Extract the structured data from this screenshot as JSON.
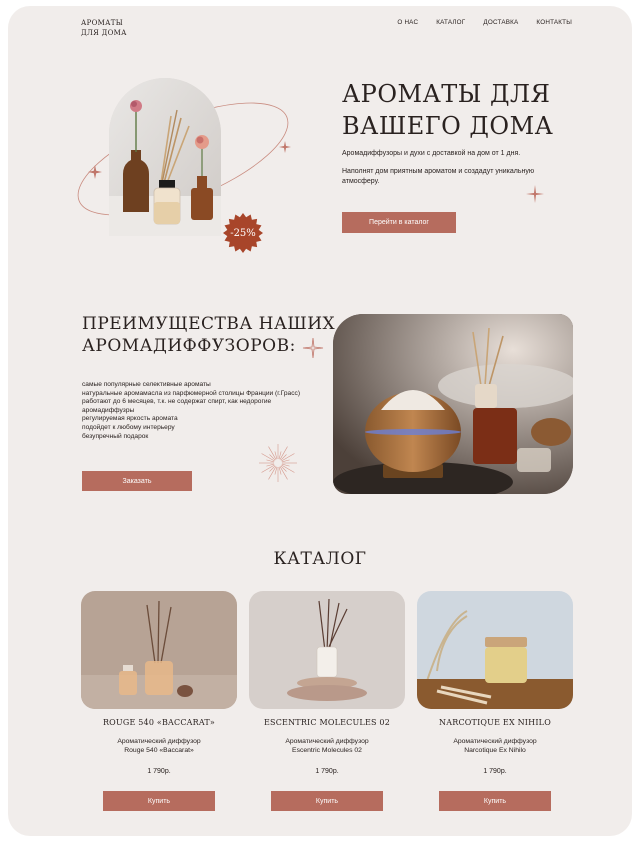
{
  "header": {
    "logo_line1": "АРОМАТЫ",
    "logo_line2": "ДЛЯ ДОМА",
    "nav": [
      "О НАС",
      "КАТАЛОГ",
      "ДОСТАВКА",
      "КОНТАКТЫ"
    ]
  },
  "hero": {
    "title_line1": "АРОМАТЫ ДЛЯ",
    "title_line2": "ВАШЕГО ДОМА",
    "subtitle": "Аромадиффузоры и духи с доставкой на дом от 1 дня.",
    "text": "Наполнят дом приятным ароматом и создадут уникальную атмосферу.",
    "button": "Перейти в каталог",
    "badge": "-25%"
  },
  "advantages": {
    "title_line1": "ПРЕИМУЩЕСТВА НАШИХ",
    "title_line2": "АРОМАДИФФУЗОРОВ:",
    "items": [
      "самые популярные селективные ароматы",
      "натуральные аромамасла из парфюмерной столицы Франции (г.Грасс)",
      "работают до 6 месяцев, т.к. не содержат спирт, как недорогие аромадиффузры",
      "регулируемая яркость аромата",
      "подойдет к любому интерьеру",
      "безупречный подарок"
    ],
    "button": "Заказать"
  },
  "catalog": {
    "title": "КАТАЛОГ",
    "products": [
      {
        "name": "ROUGE 540 «BACCARAT»",
        "desc_line1": "Ароматический диффузор",
        "desc_line2": "Rouge 540 «Baccarat»",
        "price": "1 790р.",
        "button": "Купить"
      },
      {
        "name": "ESCENTRIC MOLECULES 02",
        "desc_line1": "Ароматический диффузор",
        "desc_line2": "Escentric Molecules 02",
        "price": "1 790р.",
        "button": "Купить"
      },
      {
        "name": "NARCOTIQUE EX NIHILO",
        "desc_line1": "Ароматический диффузор",
        "desc_line2": "Narcotique Ex Nihilo",
        "price": "1 790р.",
        "button": "Купить"
      }
    ]
  },
  "colors": {
    "accent": "#b66c5e",
    "background": "#f1edeb",
    "text": "#2a2220"
  },
  "icons": [
    "sparkle-icon",
    "sunburst-icon",
    "badge-starburst-icon"
  ]
}
